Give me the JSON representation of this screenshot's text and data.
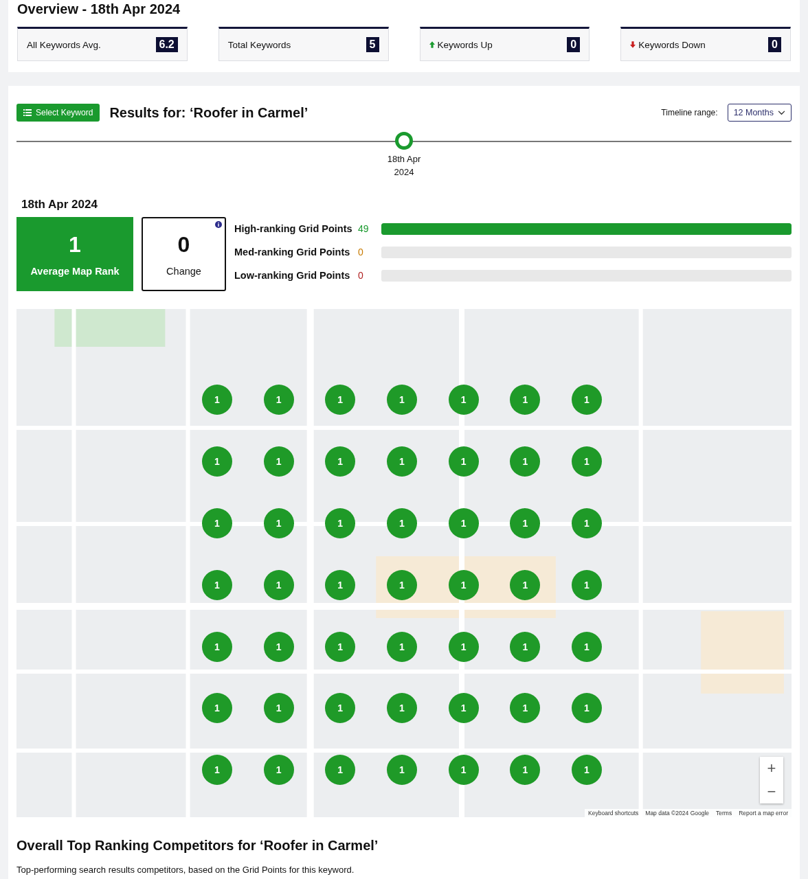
{
  "overview": {
    "title": "Overview - 18th Apr 2024",
    "cards": [
      {
        "label": "All Keywords Avg.",
        "value": "6.2",
        "kind": "plain"
      },
      {
        "label": "Total Keywords",
        "value": "5",
        "kind": "plain"
      },
      {
        "label": "Keywords Up",
        "value": "0",
        "kind": "up"
      },
      {
        "label": "Keywords Down",
        "value": "0",
        "kind": "down"
      }
    ]
  },
  "results": {
    "select_button": "Select Keyword",
    "title": "Results for: ‘Roofer in Carmel’",
    "timeline_label": "Timeline range:",
    "timeline_range": "12 Months",
    "timeline_points": [
      {
        "label": "18th Apr 2024",
        "selected": true
      }
    ]
  },
  "summary": {
    "date": "18th Apr 2024",
    "average": {
      "value": "1",
      "label": "Average Map Rank"
    },
    "change": {
      "value": "0",
      "label": "Change"
    },
    "bars": [
      {
        "label": "High-ranking Grid Points",
        "count": "49",
        "level": 1,
        "kind": "high"
      },
      {
        "label": "Med-ranking Grid Points",
        "count": "0",
        "level": 0,
        "kind": "med"
      },
      {
        "label": "Low-ranking Grid Points",
        "count": "0",
        "level": 0,
        "kind": "low"
      }
    ]
  },
  "map": {
    "grid_points": [
      [
        "1",
        "1",
        "1",
        "1",
        "1",
        "1",
        "1"
      ],
      [
        "1",
        "1",
        "1",
        "1",
        "1",
        "1",
        "1"
      ],
      [
        "1",
        "1",
        "1",
        "1",
        "1",
        "1",
        "1"
      ],
      [
        "1",
        "1",
        "1",
        "1",
        "1",
        "1",
        "1"
      ],
      [
        "1",
        "1",
        "1",
        "1",
        "1",
        "1",
        "1"
      ],
      [
        "1",
        "1",
        "1",
        "1",
        "1",
        "1",
        "1"
      ],
      [
        "1",
        "1",
        "1",
        "1",
        "1",
        "1",
        "1"
      ]
    ],
    "zoom_in": "+",
    "zoom_out": "−",
    "attribution": [
      "Keyboard shortcuts",
      "Map data ©2024 Google",
      "Terms",
      "Report a map error"
    ]
  },
  "competitors": {
    "title": "Overall Top Ranking Competitors for ‘Roofer in Carmel’",
    "subtitle": "Top-performing search results competitors, based on the Grid Points for this keyword."
  }
}
